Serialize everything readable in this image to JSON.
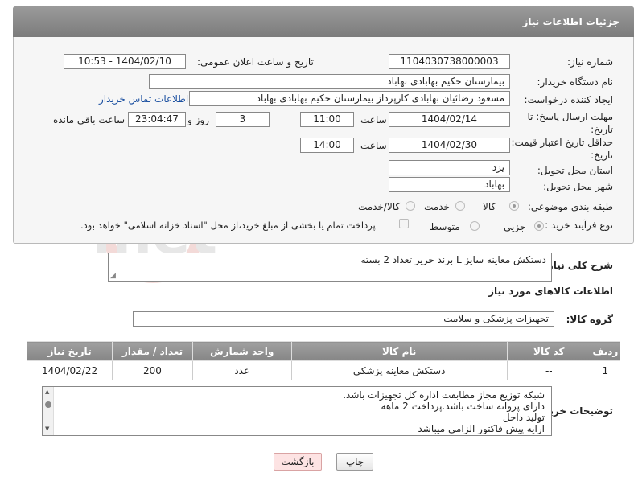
{
  "header": {
    "title": "جزئیات اطلاعات نیاز"
  },
  "fields": {
    "need_number_label": "شماره نیاز:",
    "need_number": "1104030738000003",
    "announce_label": "تاریخ و ساعت اعلان عمومی:",
    "announce_value": "1404/02/10 - 10:53",
    "buyer_label": "نام دستگاه خریدار:",
    "buyer_value": "بیمارستان حکیم بهابادی بهاباد",
    "requester_label": "ایجاد کننده درخواست:",
    "requester_value": "مسعود رضائیان بهابادی کارپرداز بیمارستان حکیم بهابادی بهاباد",
    "contact_link": "اطلاعات تماس خریدار",
    "deadline_label": "مهلت ارسال پاسخ: تا تاریخ:",
    "deadline_date": "1404/02/14",
    "time_label": "ساعت",
    "deadline_time": "11:00",
    "days_value": "3",
    "days_label": "روز و",
    "remaining_time": "23:04:47",
    "remaining_label": "ساعت باقی مانده",
    "validity_label": "حداقل تاریخ اعتبار قیمت: تا تاریخ:",
    "validity_date": "1404/02/30",
    "validity_time": "14:00",
    "province_label": "استان محل تحویل:",
    "province_value": "یزد",
    "city_label": "شهر محل تحویل:",
    "city_value": "بهاباد",
    "category_label": "طبقه بندی موضوعی:",
    "category_options": [
      "کالا",
      "خدمت",
      "کالا/خدمت"
    ],
    "process_label": "نوع فرآیند خرید :",
    "process_options": [
      "جزیی",
      "متوسط"
    ],
    "payment_text": "پرداخت تمام یا بخشی از مبلغ خرید،از محل \"اسناد خزانه اسلامی\" خواهد بود."
  },
  "description": {
    "label": "شرح کلی نیاز:",
    "value": "دستکش معاینه سایز L  برند حریر  تعداد 2 بسته"
  },
  "goods": {
    "section_title": "اطلاعات کالاهای مورد نیاز",
    "group_label": "گروه کالا:",
    "group_value": "تجهیزات پزشکی و سلامت",
    "columns": [
      "ردیف",
      "کد کالا",
      "نام کالا",
      "واحد شمارش",
      "تعداد / مقدار",
      "تاریخ نیاز"
    ],
    "rows": [
      [
        "1",
        "--",
        "دستکش معاینه پزشکی",
        "عدد",
        "200",
        "1404/02/22"
      ]
    ]
  },
  "buyer_notes": {
    "label": "توضیحات خریدار:",
    "lines": [
      "شبکه توزیع مجاز مطابقت اداره کل تجهیزات باشد.",
      "دارای پروانه ساخت باشد.پرداخت 2 ماهه",
      "تولید داخل",
      "ارایه پیش فاکتور الزامی میباشد"
    ]
  },
  "buttons": {
    "print": "چاپ",
    "back": "بازگشت"
  },
  "colors": {
    "header": "#8a8a8a",
    "link": "#1a4fa0",
    "back_button_bg": "#fde3e3"
  }
}
